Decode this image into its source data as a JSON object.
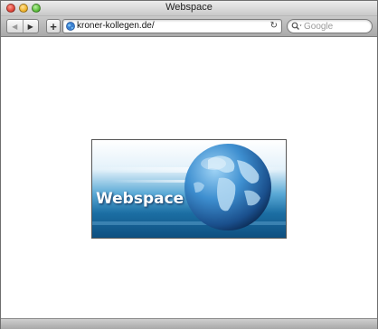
{
  "window": {
    "title": "Webspace"
  },
  "toolbar": {
    "back_icon": "back-arrow",
    "forward_icon": "forward-arrow",
    "add_label": "+",
    "address": {
      "value": "kroner-kollegen.de/",
      "icon": "globe-icon",
      "reload_icon": "reload-icon"
    },
    "search": {
      "placeholder": "Google",
      "icon": "search-icon"
    }
  },
  "content": {
    "banner": {
      "label": "Webspace",
      "image": "globe-banner"
    }
  },
  "colors": {
    "banner_blue": "#1a6fa0",
    "globe_blue": "#3a86c8"
  }
}
